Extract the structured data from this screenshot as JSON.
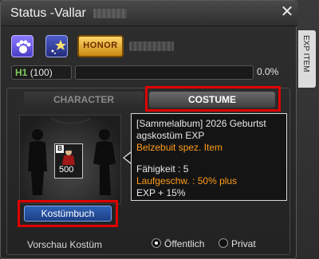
{
  "window": {
    "title": "Status -Vallar"
  },
  "badges": {
    "honor": "HONOR"
  },
  "side_tab": "EXP ITEM",
  "level": {
    "prefix": "H1",
    "value": "(100)"
  },
  "exp": {
    "percent_text": "0.0%",
    "percent": 0
  },
  "tabs": {
    "character": "CHARACTER",
    "costume": "COSTUME"
  },
  "preview": {
    "item_tag": "B",
    "item_qty": "500"
  },
  "buttons": {
    "kostuembuch": "Kostümbuch"
  },
  "info": {
    "line1": "[Sammelalbum] 2026 Geburtst",
    "line2": "agskostüm EXP",
    "line3": "Belzebuit spez. Item",
    "line4": "Fähigkeit : 5",
    "line5": "Laufgeschw. : 50% plus",
    "line6": "EXP + 15%"
  },
  "footer": {
    "vorschau": "Vorschau Kostüm",
    "opt_public": "Öffentlich",
    "opt_private": "Privat"
  },
  "colors": {
    "highlight": "#e00000",
    "accent_orange": "#ff9c1a",
    "button_blue": "#2f61b5"
  }
}
